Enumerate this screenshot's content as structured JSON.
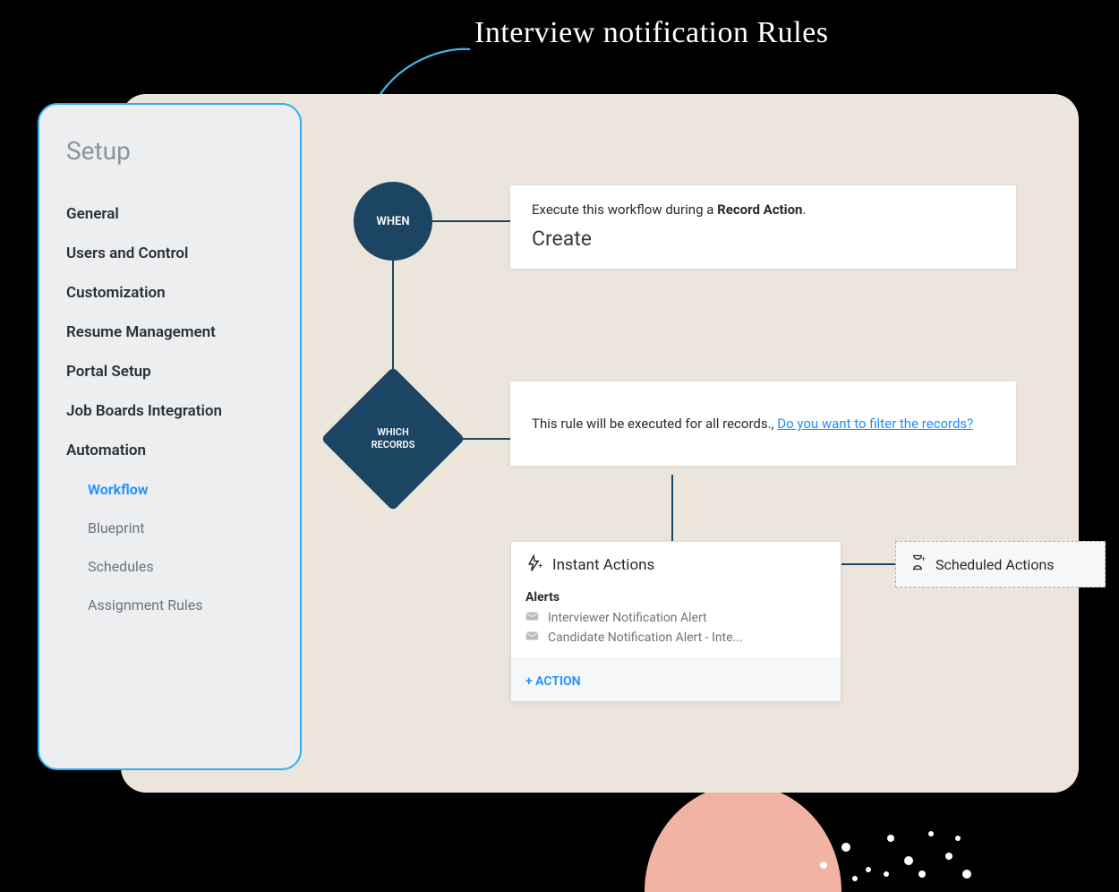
{
  "annotation": {
    "title": "Interview notification Rules"
  },
  "sidebar": {
    "title": "Setup",
    "items": [
      "General",
      "Users and Control",
      "Customization",
      "Resume Management",
      "Portal Setup",
      "Job Boards Integration",
      "Automation"
    ],
    "subitems": [
      "Workflow",
      "Blueprint",
      "Schedules",
      "Assignment Rules"
    ],
    "active_subitem": "Workflow"
  },
  "workflow": {
    "when": {
      "node_label": "WHEN",
      "text_prefix": "Execute this workflow during a ",
      "text_bold": "Record Action",
      "text_suffix": ".",
      "action": "Create"
    },
    "which": {
      "node_label_line1": "WHICH",
      "node_label_line2": "RECORDS",
      "text": "This rule will be executed for all records., ",
      "link": "Do you want to filter the records?"
    },
    "instant": {
      "title": "Instant Actions",
      "alerts_label": "Alerts",
      "alerts": [
        "Interviewer Notification Alert",
        "Candidate Notification Alert - Inte..."
      ],
      "add_action_label": "+ ACTION"
    },
    "scheduled": {
      "title": "Scheduled Actions"
    }
  }
}
